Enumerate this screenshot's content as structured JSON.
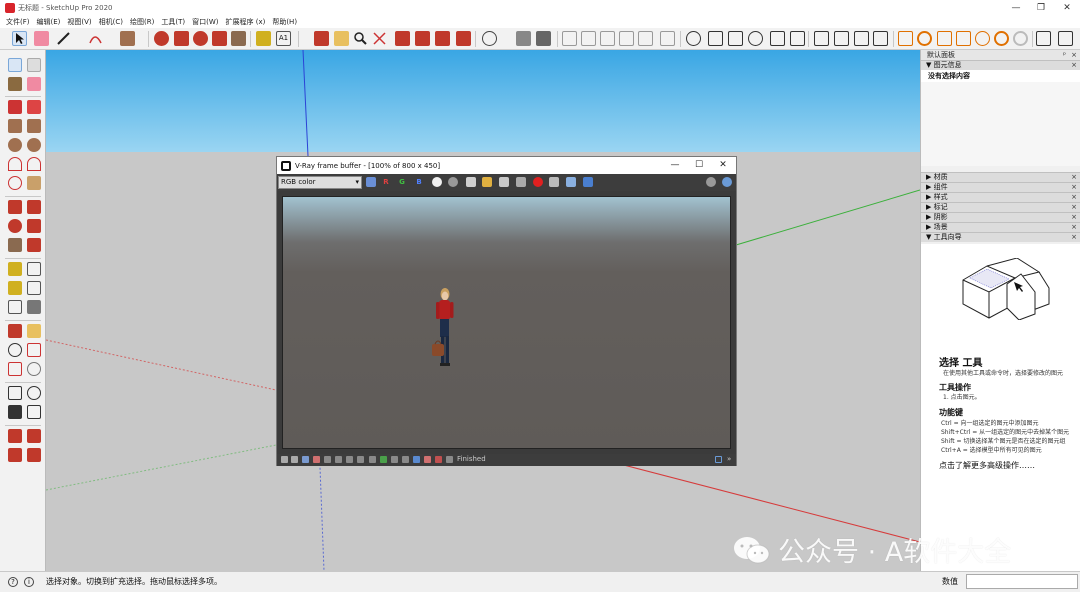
{
  "window": {
    "title": "无标题 - SketchUp Pro 2020",
    "controls": [
      "—",
      "❐",
      "✕"
    ]
  },
  "menu": [
    "文件(F)",
    "编辑(E)",
    "视图(V)",
    "相机(C)",
    "绘图(R)",
    "工具(T)",
    "窗口(W)",
    "扩展程序 (x)",
    "帮助(H)"
  ],
  "vfb": {
    "title": "V-Ray frame buffer - [100% of 800 x 450]",
    "channel": "RGB color",
    "channel_buttons": [
      "R",
      "G",
      "B"
    ],
    "status": "Finished",
    "controls": [
      "—",
      "☐",
      "✕"
    ]
  },
  "tray": {
    "title": "默认面板",
    "entity_info": "图元信息",
    "entity_value": "没有选择内容",
    "sections": [
      "材质",
      "组件",
      "样式",
      "标记",
      "阴影",
      "场景",
      "工具向导"
    ],
    "instructor": {
      "title": "选择 工具",
      "intro": "在使用其他工具或命令时，选择要修改的图元",
      "ops_title": "工具操作",
      "op1": "1. 点击图元。",
      "keys_title": "功能键",
      "keys": [
        "Ctrl = 向一组选定的图元中添加图元",
        "Shift+Ctrl = 从一组选定的图元中去掉某个图元",
        "Shift = 切换选择某个图元是否在选定的图元组",
        "Ctrl+A = 选择模型中所有可见的图元"
      ],
      "more": "点击了解更多高级操作……"
    }
  },
  "statusbar": {
    "hint": "选择对象。切换到扩充选择。拖动鼠标选择多项。",
    "measure_label": "数值",
    "measure_value": ""
  },
  "watermark": "公众号 · A软件大全",
  "colors": {
    "sky_top": "#39a6e4",
    "ground": "#c8c8c8",
    "axis_blue": "#2b43d6",
    "axis_green": "#3bb03b",
    "axis_red": "#d63b3b",
    "vray_bg": "#3b3b3b"
  }
}
